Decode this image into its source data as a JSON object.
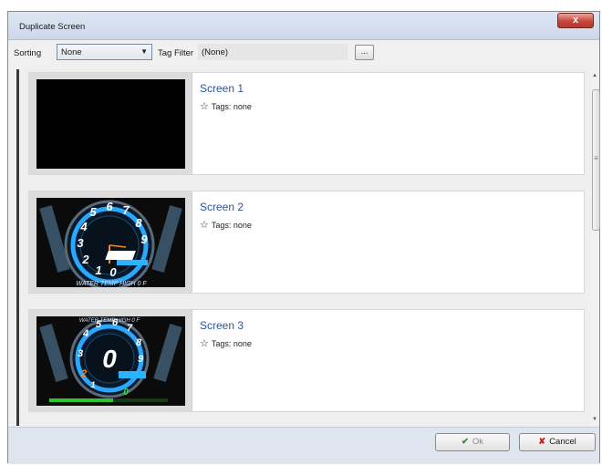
{
  "window": {
    "title": "Duplicate Screen",
    "close_glyph": "x"
  },
  "toolbar": {
    "sorting_label": "Sorting",
    "sorting_value": "None",
    "tag_filter_label": "Tag Filter",
    "tag_filter_value": "(None)",
    "tag_filter_button": "..."
  },
  "screens": [
    {
      "name": "Screen 1",
      "tags": "Tags: none",
      "thumbnail": "blank-black"
    },
    {
      "name": "Screen 2",
      "tags": "Tags: none",
      "thumbnail": "dashboard-gauge"
    },
    {
      "name": "Screen 3",
      "tags": "Tags: none",
      "thumbnail": "dashboard-gauge-digital"
    }
  ],
  "gauges": {
    "screen2": {
      "numbers": [
        "1",
        "2",
        "3",
        "4",
        "5",
        "6",
        "7",
        "8",
        "9",
        "0"
      ],
      "banner": "WATER TEMP HIGH 0 F"
    },
    "screen3": {
      "numbers": [
        "1",
        "2",
        "3",
        "4",
        "5",
        "6",
        "7",
        "8",
        "9"
      ],
      "banner": "WATER TEMP HIGH 0 F",
      "gear": "0",
      "speed": "0"
    }
  },
  "footer": {
    "ok_label": "Ok",
    "cancel_label": "Cancel"
  },
  "colors": {
    "accent_blue": "#2a55a0",
    "ok_green": "#2e8b2e",
    "cancel_red": "#c02020"
  }
}
